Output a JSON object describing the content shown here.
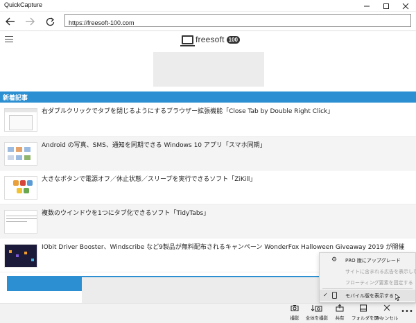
{
  "window": {
    "title": "QuickCapture",
    "minimize_icon": "minimize-icon",
    "maximize_icon": "maximize-icon",
    "close_icon": "close-icon"
  },
  "nav": {
    "back_icon": "back-arrow-icon",
    "forward_icon": "forward-arrow-icon",
    "reload_icon": "reload-icon",
    "url": "https://freesoft-100.com"
  },
  "site": {
    "logo_text": "freesoft",
    "logo_badge": "100",
    "section_title": "新着記事"
  },
  "articles": [
    {
      "title": "右ダブルクリックでタブを閉じるようにするブラウザー拡張機能「Close Tab by Double Right Click」"
    },
    {
      "title": "Android の写真、SMS、通知を同期できる Windows 10 アプリ「スマホ同期」"
    },
    {
      "title": "大きなボタンで電源オフ／休止状態／スリープを実行できるソフト「ZiKill」"
    },
    {
      "title": "複数のウインドウを1つにタブ化できるソフト「TidyTabs」"
    },
    {
      "title": "IObit Driver Booster、Windscribe など9製品が無料配布されるキャンペーン WonderFox Halloween Giveaway 2019 が開催"
    }
  ],
  "toolbar": {
    "capture_label": "撮影",
    "fullpage_label": "全体を撮影",
    "share_label": "共有",
    "open_folder_label": "フォルダを開く",
    "cancel_label": "キャンセル",
    "more_icon": "more-icon"
  },
  "menu": {
    "upgrade_label": "PRO 版にアップグレード",
    "hide_ads_label": "サイトに含まれる広告を表示しない",
    "fix_floating_label": "フローティング要素を固定する",
    "mobile_label": "モバイル版を表示する"
  }
}
